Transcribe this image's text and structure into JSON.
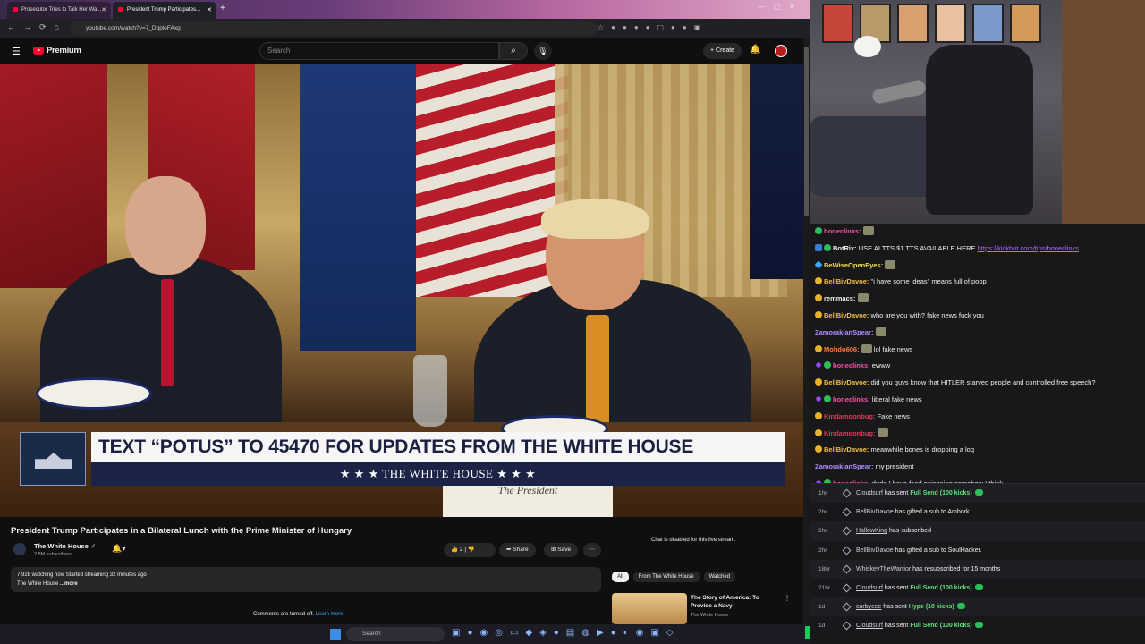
{
  "browser": {
    "tabs": [
      {
        "title": "Prosecutor Tries to Talk Her Wa..."
      },
      {
        "title": "President Trump Participates..."
      }
    ],
    "url": "youtube.com/watch?v=7_DqpleFAxg"
  },
  "youtube": {
    "logo_text": "Premium",
    "search_placeholder": "Search",
    "create_label": "Create",
    "video": {
      "lower_third_headline": "TEXT “POTUS” TO 45470 FOR UPDATES FROM THE WHITE HOUSE",
      "lower_third_sub": "★ ★ ★  THE WHITE HOUSE  ★ ★ ★",
      "placecard": "The President"
    },
    "title": "President Trump Participates in a Bilateral Lunch with the Prime Minister of Hungary",
    "channel": {
      "name": "The White House",
      "subscribers": "2.8M subscribers"
    },
    "actions": {
      "like_count": "2",
      "share": "Share",
      "save": "Save"
    },
    "description": {
      "stats": "7,928 watching now  Started streaming 32 minutes ago",
      "line2": "The White House",
      "more": "...more"
    },
    "comments_off": "Comments are turned off.",
    "learn_more": "Learn more",
    "chat_disabled": "Chat is disabled for this live stream.",
    "chips": [
      "All",
      "From The White House",
      "Watched"
    ],
    "recommendation": {
      "title": "The Story of America: To Provide a Navy",
      "channel": "The White House"
    }
  },
  "taskbar": {
    "search": "Search"
  },
  "chat": {
    "messages": [
      {
        "user": "boneclinks:",
        "color": "#ff4da6",
        "badges": [
          "sub"
        ],
        "text": "",
        "emote": true
      },
      {
        "user": "BotRix:",
        "color": "#efeff1",
        "badges": [
          "bot",
          "sub"
        ],
        "text": "USE AI TTS $1 TTS AVAILABLE HERE ",
        "link": "https://kickbot.com/tips/boneclinks"
      },
      {
        "user": "BeWiseOpenEyes:",
        "color": "#f0e14a",
        "badges": [
          "diamond"
        ],
        "text": "",
        "emote": true
      },
      {
        "user": "BellBivDavoe:",
        "color": "#f0c040",
        "badges": [
          "gift"
        ],
        "text": "\"i have some ideas\" means full of poop"
      },
      {
        "user": "remmacs:",
        "color": "#efeff1",
        "badges": [
          "gift"
        ],
        "text": "",
        "emote": true
      },
      {
        "user": "BellBivDavoe:",
        "color": "#f0c040",
        "badges": [
          "gift"
        ],
        "text": "who are you with? fake news fuck you"
      },
      {
        "user": "ZamorakianSpear:",
        "color": "#b18cff",
        "badges": [],
        "text": "",
        "emote": true
      },
      {
        "user": "Mohdo606:",
        "color": "#ff7a3a",
        "badges": [
          "gift"
        ],
        "text": "lol fake news",
        "emote_before": true
      },
      {
        "user": "boneclinks:",
        "color": "#ff4da6",
        "badges": [
          "mod",
          "sub"
        ],
        "text": "ewww"
      },
      {
        "user": "BellBivDavoe:",
        "color": "#f0c040",
        "badges": [
          "gift"
        ],
        "text": "did you guys know that HITLER starved people and controlled free speech?"
      },
      {
        "user": "boneclinks:",
        "color": "#ff4da6",
        "badges": [
          "mod",
          "sub"
        ],
        "text": "liberal fake news"
      },
      {
        "user": "Kindamoonbug:",
        "color": "#e8335a",
        "badges": [
          "gift"
        ],
        "text": "Fake news"
      },
      {
        "user": "Kindamoonbug:",
        "color": "#e8335a",
        "badges": [
          "gift"
        ],
        "text": "",
        "emote": true
      },
      {
        "user": "BellBivDavoe:",
        "color": "#f0c040",
        "badges": [
          "gift"
        ],
        "text": "meanwhile bones is dropping a log"
      },
      {
        "user": "ZamorakianSpear:",
        "color": "#b18cff",
        "badges": [],
        "text": "my president"
      },
      {
        "user": "boneclinks:",
        "color": "#ff4da6",
        "badges": [
          "mod",
          "sub"
        ],
        "text": "dude I have food poisoning somehow I think"
      }
    ]
  },
  "feed": {
    "rows": [
      {
        "time": "1hr",
        "user": "Cloudsurf",
        "underline": true,
        "text": " has sent ",
        "highlight": "Full Send (100 kicks)",
        "gift": true
      },
      {
        "time": "2hr",
        "user": "BellBivDavoe",
        "underline": false,
        "text": " has gifted a sub to ",
        "highlight_plain": "Ambork."
      },
      {
        "time": "2hr",
        "user": "HallowKing",
        "underline": true,
        "text": " has subscribed"
      },
      {
        "time": "2hr",
        "user": "BellBivDavoe",
        "underline": false,
        "text": " has gifted a sub to ",
        "highlight_plain": "SoulHacker."
      },
      {
        "time": "18hr",
        "user": "WhiskeyTheWarrior",
        "underline": true,
        "text": " has resubscribed for 15 months"
      },
      {
        "time": "21hr",
        "user": "Cloudsurf",
        "underline": true,
        "text": " has sent ",
        "highlight": "Full Send (100 kicks)",
        "gift": true
      },
      {
        "time": "1d",
        "user": "carbycee",
        "underline": true,
        "text": " has sent ",
        "highlight": "Hype (10 kicks)",
        "gift": true
      },
      {
        "time": "1d",
        "user": "Cloudsurf",
        "underline": true,
        "text": " has sent ",
        "highlight": "Full Send (100 kicks)",
        "gift": true
      }
    ]
  }
}
